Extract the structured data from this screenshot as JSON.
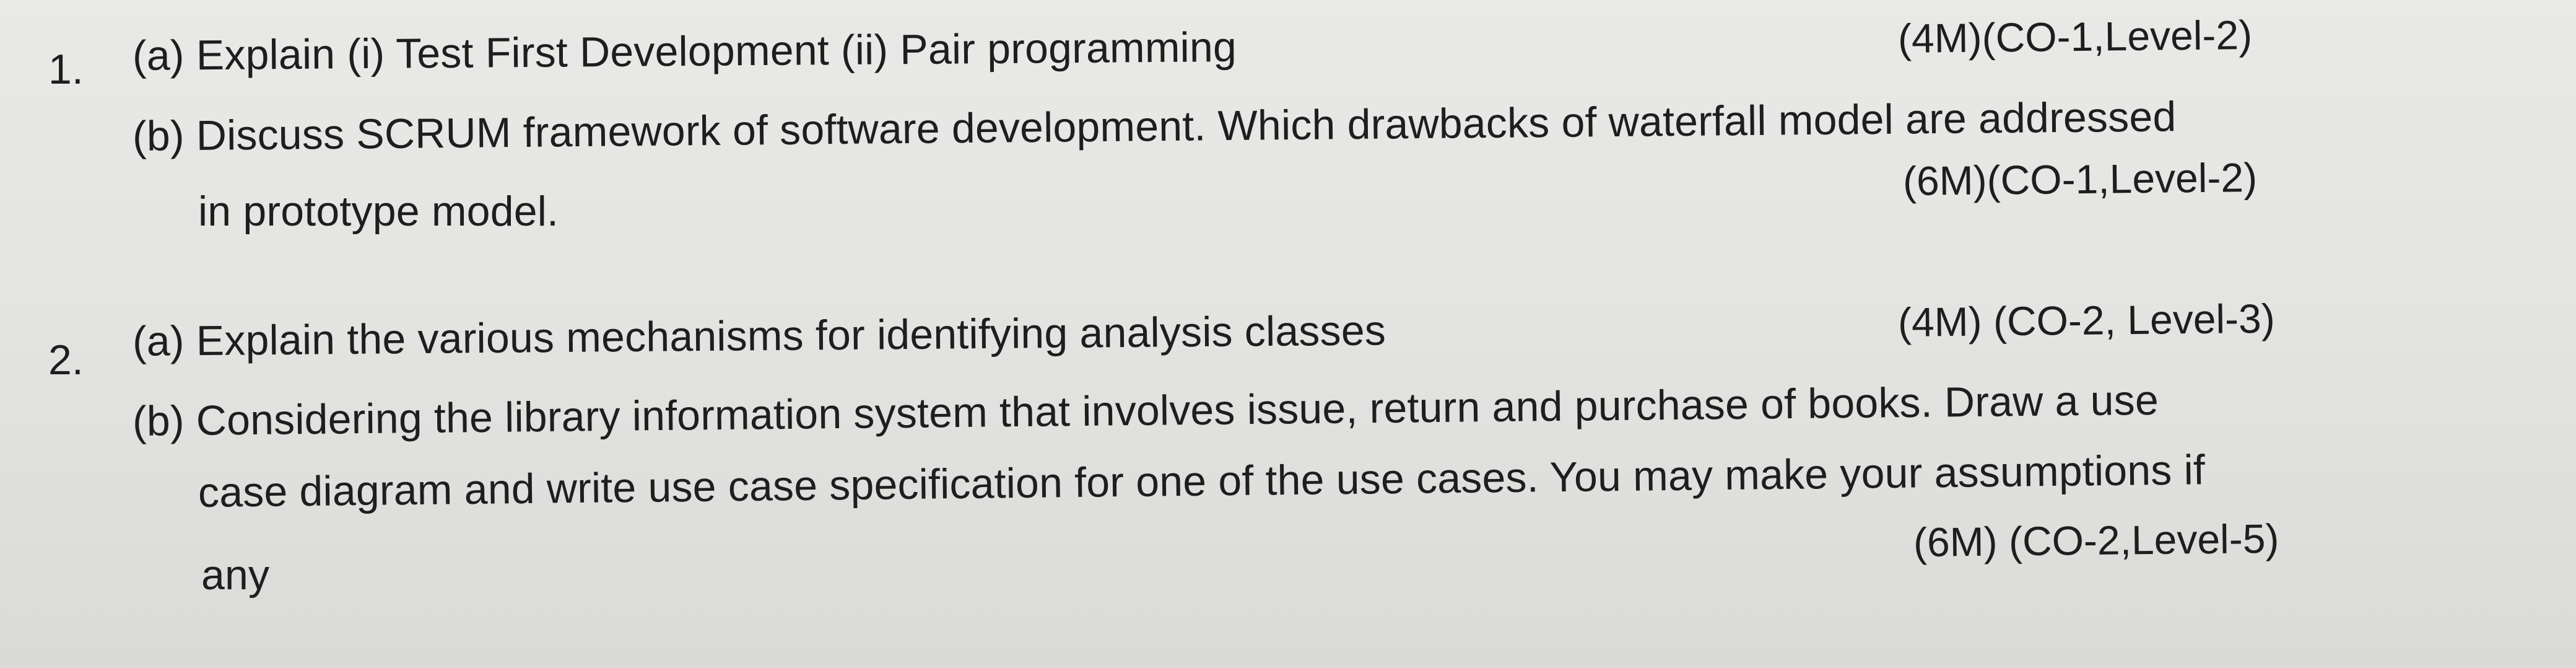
{
  "questions": [
    {
      "number": "1.",
      "part_a": {
        "text": "(a) Explain (i) Test First Development  (ii) Pair programming",
        "marks": "(4M)(CO-1,Level-2)"
      },
      "part_b": {
        "line1": "(b) Discuss SCRUM framework of software development. Which drawbacks of waterfall model are addressed",
        "line2": "in prototype model.",
        "marks": "(6M)(CO-1,Level-2)"
      }
    },
    {
      "number": "2.",
      "part_a": {
        "text": "(a) Explain the various mechanisms for identifying analysis classes",
        "marks": "(4M)  (CO-2, Level-3)"
      },
      "part_b": {
        "line1": "(b) Considering the library information system that involves issue, return and purchase of books. Draw a use",
        "line2": "case diagram and write use case specification for one of the use cases. You may make your assumptions if",
        "line3": "any",
        "marks": "(6M) (CO-2,Level-5)"
      }
    }
  ]
}
